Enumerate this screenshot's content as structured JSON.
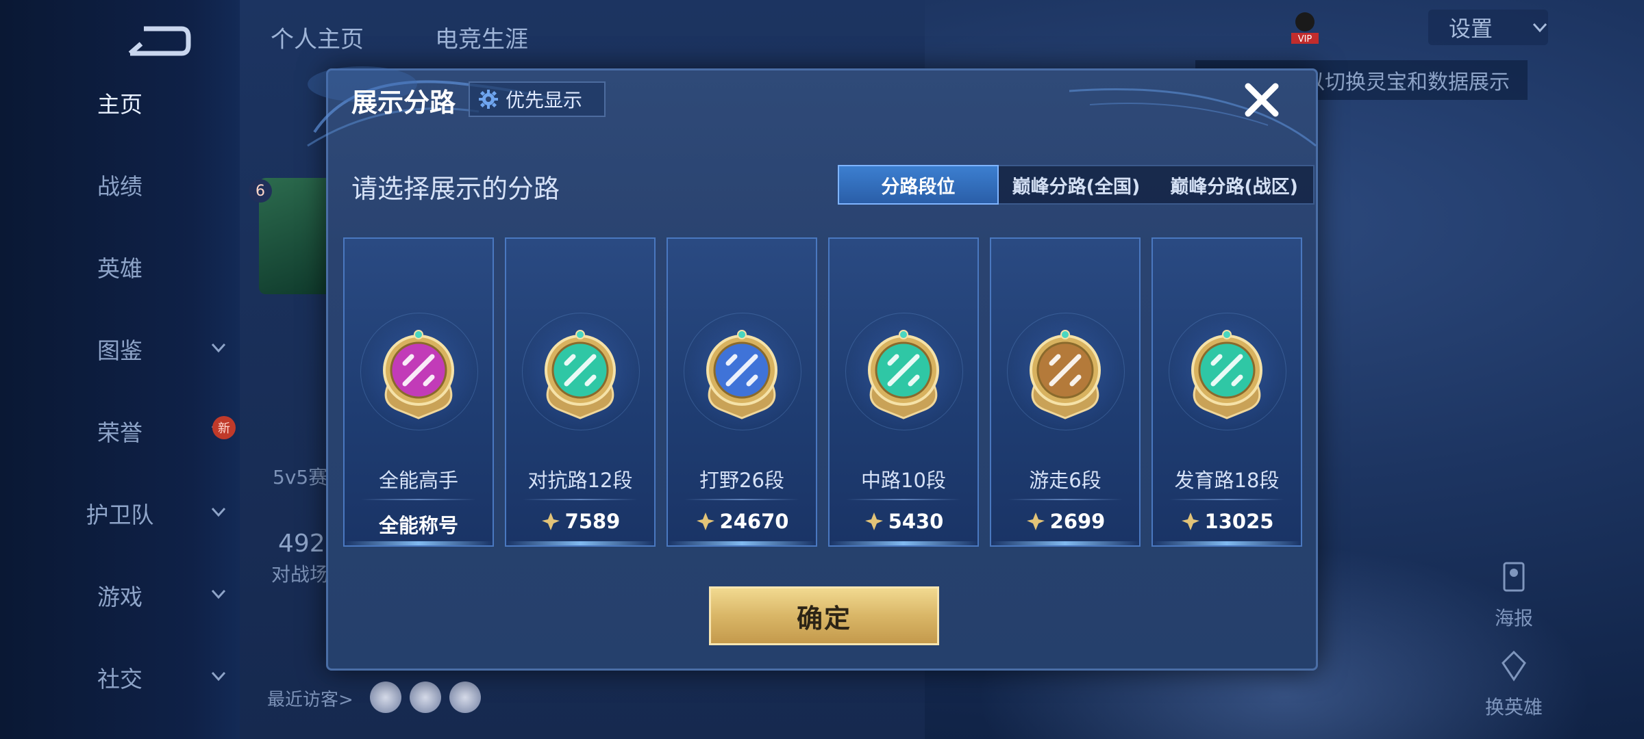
{
  "sidebar": {
    "items": [
      {
        "label": "主页",
        "active": true,
        "has_chevron": false
      },
      {
        "label": "战绩",
        "active": false,
        "has_chevron": false
      },
      {
        "label": "英雄",
        "active": false,
        "has_chevron": false
      },
      {
        "label": "图鉴",
        "active": false,
        "has_chevron": true
      },
      {
        "label": "荣誉",
        "active": false,
        "has_chevron": true
      },
      {
        "label": "护卫队",
        "active": false,
        "has_chevron": true
      },
      {
        "label": "游戏",
        "active": false,
        "has_chevron": true
      },
      {
        "label": "社交",
        "active": false,
        "has_chevron": true
      }
    ],
    "new_badge": "新"
  },
  "header": {
    "tabs": [
      "个人主页",
      "电竞生涯"
    ],
    "settings_label": "设置",
    "vip_label": "VIP",
    "hint": "以切换灵宝和数据展示"
  },
  "background": {
    "hero_count": "6",
    "mode_text": "5v5赛",
    "number_text": "492",
    "battle_text": "对战场",
    "visitors_label": "最近访客>",
    "poster_label": "海报",
    "swap_hero_label": "换英雄"
  },
  "modal": {
    "title": "展示分路",
    "priority_label": "优先显示",
    "subtitle": "请选择展示的分路",
    "segments": [
      {
        "label": "分路段位",
        "active": true
      },
      {
        "label": "巅峰分路(全国)",
        "active": false
      },
      {
        "label": "巅峰分路(战区)",
        "active": false
      }
    ],
    "cards": [
      {
        "name": "全能高手",
        "score": "全能称号",
        "has_score_icon": false,
        "badge": "all-round-badge-icon",
        "color": "#c23bb8"
      },
      {
        "name": "对抗路12段",
        "score": "7589",
        "has_score_icon": true,
        "badge": "clash-lane-badge-icon",
        "color": "#2fc7a5"
      },
      {
        "name": "打野26段",
        "score": "24670",
        "has_score_icon": true,
        "badge": "jungle-badge-icon",
        "color": "#3f73d8"
      },
      {
        "name": "中路10段",
        "score": "5430",
        "has_score_icon": true,
        "badge": "mid-lane-badge-icon",
        "color": "#2fc7a5"
      },
      {
        "name": "游走6段",
        "score": "2699",
        "has_score_icon": true,
        "badge": "roam-badge-icon",
        "color": "#b47a3a"
      },
      {
        "name": "发育路18段",
        "score": "13025",
        "has_score_icon": true,
        "badge": "farm-lane-badge-icon",
        "color": "#2fc7a5"
      }
    ],
    "confirm_label": "确定"
  },
  "colors": {
    "accent": "#3c7fd0",
    "gold": "#d9b667"
  }
}
